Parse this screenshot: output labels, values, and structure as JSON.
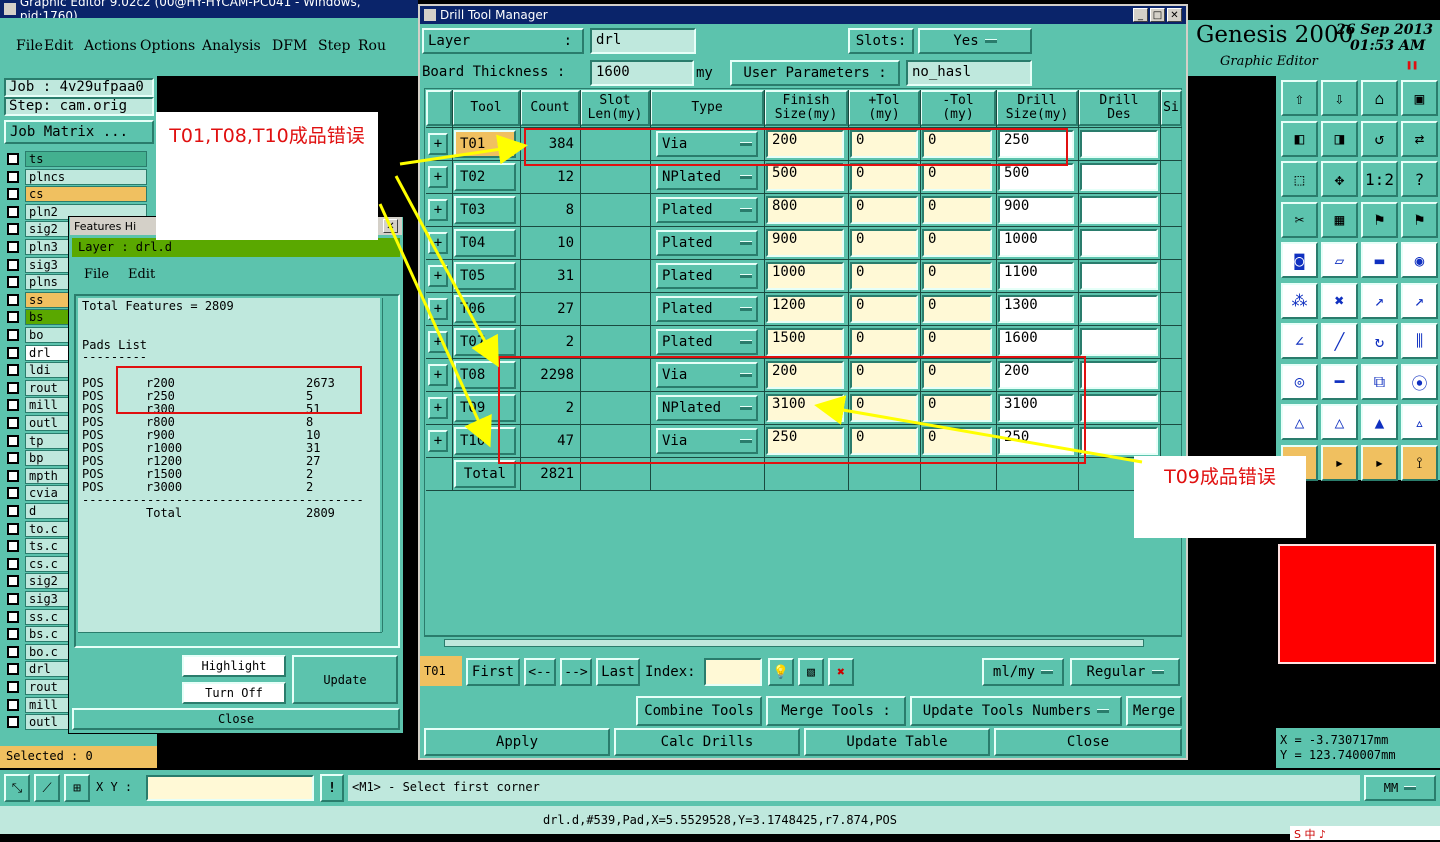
{
  "main_window": {
    "title": "Graphic Editor 9.02c2 (00@HY-HYCAM-PC041 - Windows, pid:1760)",
    "menu": [
      "File",
      "Edit",
      "Actions",
      "Options",
      "Analysis",
      "DFM",
      "Step",
      "Rou"
    ],
    "job_label": "Job : 4v29ufpaa0",
    "step_label": "Step: cam.orig",
    "job_matrix_button": "Job Matrix ...",
    "layers": [
      "ts",
      "plncs",
      "cs",
      "pln2",
      "sig2",
      "pln3",
      "sig3",
      "plns",
      "ss",
      "bs",
      "bo",
      "drl",
      "ldi",
      "rout",
      "mill",
      "outl",
      "tp",
      "bp",
      "mpth",
      "cvia",
      "d",
      "to.c",
      "ts.c",
      "cs.c",
      "sig2",
      "sig3",
      "ss.c",
      "bs.c",
      "bo.c",
      "drl",
      "rout",
      "mill",
      "outl"
    ],
    "selected_label": "Selected : 0",
    "xy_label": "X Y :",
    "prompt": "<M1> - Select first corner",
    "units": "MM",
    "status_line": "drl.d,#539,Pad,X=5.5529528,Y=3.1748425,r7.874,POS",
    "brand": "Genesis 2000",
    "brand_sub": "Graphic Editor",
    "date": "26 Sep 2013",
    "time": "01:53 AM",
    "coord_x": "X = -3.730717mm",
    "coord_y": "Y = 123.740007mm",
    "ime": "S 中 ♪"
  },
  "features_window": {
    "title": "Features Hi",
    "layer_label": "Layer :  drl.d",
    "menu": [
      "File",
      "Edit"
    ],
    "total_features": "Total Features = 2809",
    "pads_title": "Pads List",
    "underline": "---------",
    "rows": [
      {
        "type": "POS",
        "sym": "r200",
        "count": "2673"
      },
      {
        "type": "POS",
        "sym": "r250",
        "count": "5"
      },
      {
        "type": "POS",
        "sym": "r300",
        "count": "51"
      },
      {
        "type": "POS",
        "sym": "r800",
        "count": "8"
      },
      {
        "type": "POS",
        "sym": "r900",
        "count": "10"
      },
      {
        "type": "POS",
        "sym": "r1000",
        "count": "31"
      },
      {
        "type": "POS",
        "sym": "r1200",
        "count": "27"
      },
      {
        "type": "POS",
        "sym": "r1500",
        "count": "2"
      },
      {
        "type": "POS",
        "sym": "r3000",
        "count": "2"
      }
    ],
    "separator": "---------------------------------------",
    "total_label": "Total",
    "total_value": "2809",
    "highlight_button": "Highlight",
    "turn_off_button": "Turn Off",
    "update_button": "Update",
    "close_button": "Close"
  },
  "drill_window": {
    "title": "Drill Tool Manager",
    "layer_label": "Layer",
    "layer_colon": ":",
    "layer_value": "drl",
    "slots_label": "Slots:",
    "slots_value": "Yes",
    "board_thickness_label": "Board Thickness :",
    "board_thickness_value": "1600",
    "board_thickness_unit": "my",
    "user_params_label": "User Parameters :",
    "user_params_value": "no_hasl",
    "columns": [
      "Tool",
      "Count",
      "Slot\nLen(my)",
      "Type",
      "Finish\nSize(my)",
      "+Tol\n(my)",
      "-Tol\n(my)",
      "Drill\nSize(my)",
      "Drill\nDes",
      "Si"
    ],
    "rows": [
      {
        "tool": "T01",
        "count": "384",
        "type": "Via",
        "finish": "200",
        "ptol": "0",
        "mtol": "0",
        "drill": "250"
      },
      {
        "tool": "T02",
        "count": "12",
        "type": "NPlated",
        "finish": "500",
        "ptol": "0",
        "mtol": "0",
        "drill": "500"
      },
      {
        "tool": "T03",
        "count": "8",
        "type": "Plated",
        "finish": "800",
        "ptol": "0",
        "mtol": "0",
        "drill": "900"
      },
      {
        "tool": "T04",
        "count": "10",
        "type": "Plated",
        "finish": "900",
        "ptol": "0",
        "mtol": "0",
        "drill": "1000"
      },
      {
        "tool": "T05",
        "count": "31",
        "type": "Plated",
        "finish": "1000",
        "ptol": "0",
        "mtol": "0",
        "drill": "1100"
      },
      {
        "tool": "T06",
        "count": "27",
        "type": "Plated",
        "finish": "1200",
        "ptol": "0",
        "mtol": "0",
        "drill": "1300"
      },
      {
        "tool": "T07",
        "count": "2",
        "type": "Plated",
        "finish": "1500",
        "ptol": "0",
        "mtol": "0",
        "drill": "1600"
      },
      {
        "tool": "T08",
        "count": "2298",
        "type": "Via",
        "finish": "200",
        "ptol": "0",
        "mtol": "0",
        "drill": "200"
      },
      {
        "tool": "T09",
        "count": "2",
        "type": "NPlated",
        "finish": "3100",
        "ptol": "0",
        "mtol": "0",
        "drill": "3100"
      },
      {
        "tool": "T10",
        "count": "47",
        "type": "Via",
        "finish": "250",
        "ptol": "0",
        "mtol": "0",
        "drill": "250"
      }
    ],
    "total_label": "Total",
    "total_value": "2821",
    "current_tool": "T01",
    "first_button": "First",
    "prev_button": "<--",
    "next_button": "-->",
    "last_button": "Last",
    "index_label": "Index:",
    "units_value": "ml/my",
    "mode_value": "Regular",
    "combine_button": "Combine Tools",
    "merge_tools_label": "Merge Tools :",
    "update_numbers_value": "Update Tools Numbers",
    "merge_button": "Merge",
    "apply_button": "Apply",
    "calc_button": "Calc Drills",
    "update_table_button": "Update Table",
    "close_button": "Close"
  },
  "annotations": {
    "note_top": "T01,T08,T10成品错误",
    "note_bottom": "T09成品错误"
  }
}
